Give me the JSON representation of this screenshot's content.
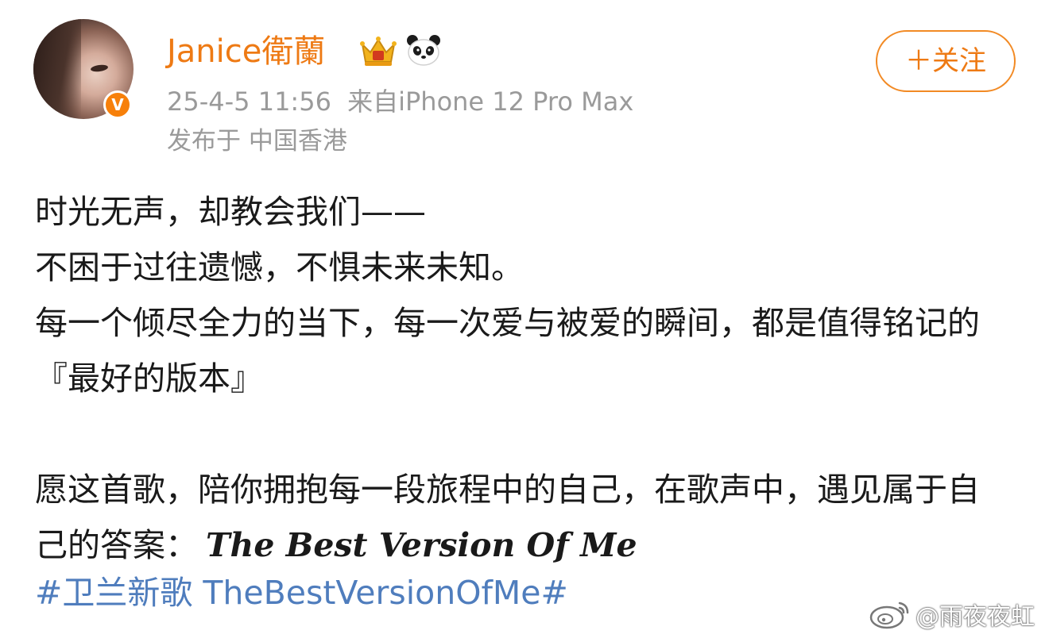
{
  "post": {
    "author": {
      "name": "Janice衛蘭",
      "verified_mark": "V",
      "badges": [
        "crown-icon",
        "panda-icon"
      ]
    },
    "meta": {
      "timestamp": "25-4-5 11:56",
      "source": "来自iPhone 12 Pro Max",
      "location": "发布于 中国香港"
    },
    "follow_label": "＋关注",
    "content": {
      "line1": "时光无声，却教会我们——",
      "line2": "不困于过往遗憾，不惧未来未知。",
      "line3": "每一个倾尽全力的当下，每一次爱与被爱的瞬间，都是值得铭记的『最好的版本』",
      "line4_prefix": "愿这首歌，陪你拥抱每一段旅程中的自己，在歌声中，遇见属于自己的答案：",
      "song_title": "The Best Version Of Me",
      "hashtag": "#卫兰新歌 TheBestVersionOfMe#"
    }
  },
  "watermark": {
    "icon": "weibo-icon",
    "text": "@雨夜夜虹"
  },
  "colors": {
    "accent": "#ee7a14",
    "hashtag": "#4f7dbd",
    "meta": "#9a9a9a",
    "verified": "#f7800a"
  }
}
